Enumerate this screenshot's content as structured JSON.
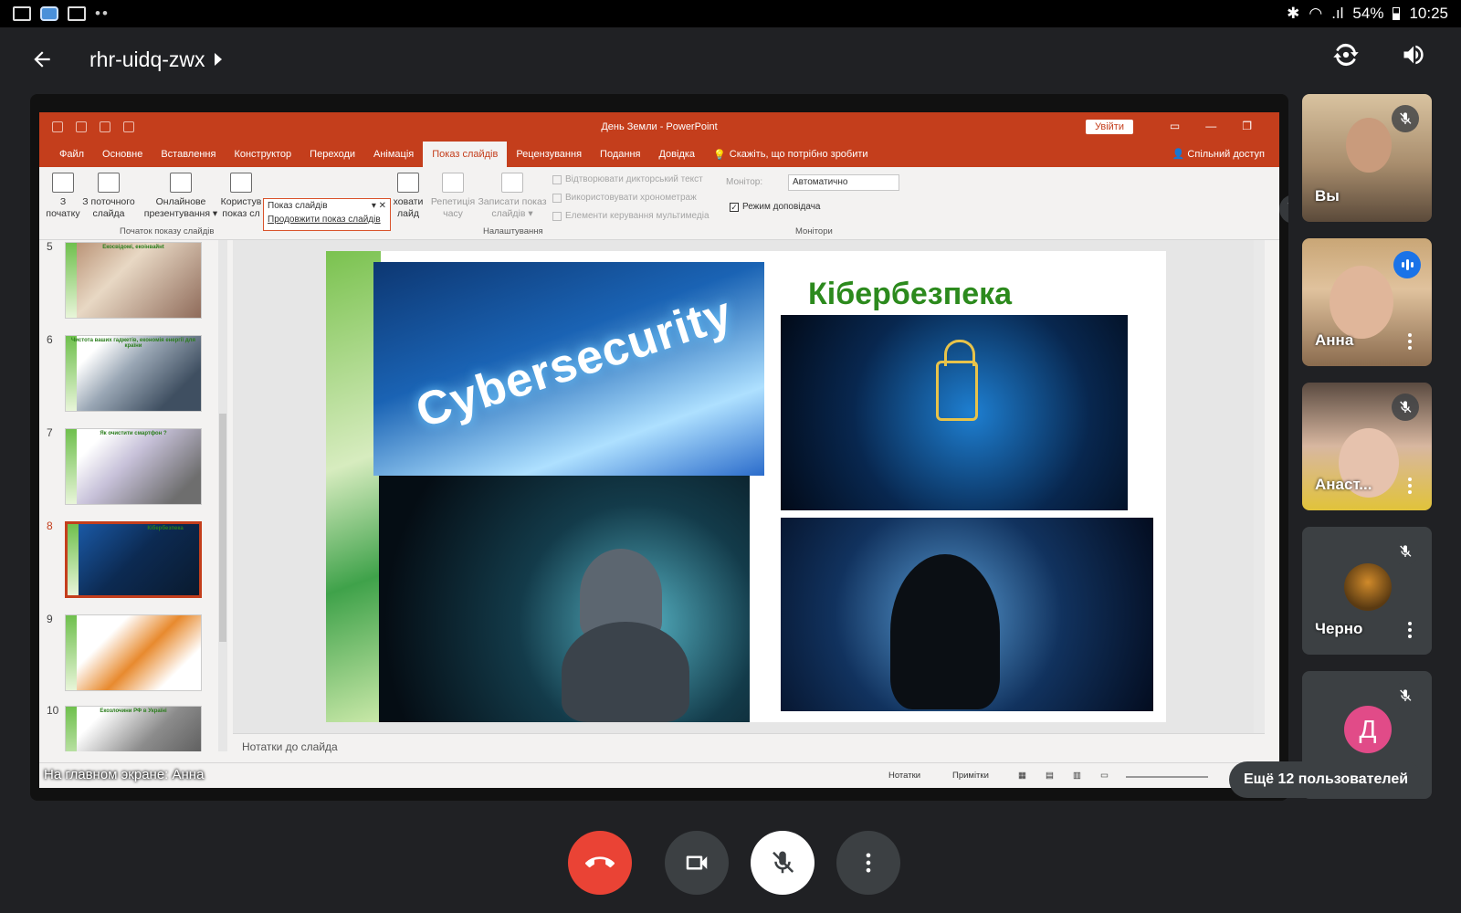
{
  "status_bar": {
    "battery": "54%",
    "time": "10:25",
    "signal_label": ".ıl"
  },
  "header": {
    "meeting_code": "rhr-uidq-zwx"
  },
  "powerpoint": {
    "doc_title": "День Земли  -  PowerPoint",
    "signin_label": "Увійти",
    "tabs": [
      "Файл",
      "Основне",
      "Вставлення",
      "Конструктор",
      "Переходи",
      "Анімація",
      "Показ слайдів",
      "Рецензування",
      "Подання",
      "Довідка"
    ],
    "tell_me": "Скажіть, що потрібно зробити",
    "share_label": "Спільний доступ",
    "ribbon": {
      "from_beginning": [
        "З",
        "початку"
      ],
      "from_current": [
        "З поточного",
        "слайда"
      ],
      "online": [
        "Онлайнове",
        "презентування ▾"
      ],
      "custom": [
        "Користув",
        "показ сл"
      ],
      "hide": [
        "ховати",
        "лайд"
      ],
      "rehearse": [
        "Репетиція",
        "часу"
      ],
      "record": [
        "Записати показ",
        "слайдів ▾"
      ],
      "group_start": "Початок показу слайдів",
      "group_setup": "Налаштування",
      "group_monitors": "Монітори",
      "checkbox_narration": "Відтворювати дикторський текст",
      "checkbox_timings": "Використовувати хронометраж",
      "checkbox_media": "Елементи керування мультимедіа",
      "monitor_label": "Монітор:",
      "monitor_value": "Автоматично",
      "presenter_view": "Режим доповідача",
      "popup_item1": "Показ слайдів",
      "popup_item2": "Продовжити показ слайдів"
    },
    "thumbnails": [
      {
        "num": "5",
        "title": "Екосвідомі, екоінвайнt"
      },
      {
        "num": "6",
        "title": "Чистота ваших гаджетів, економія енергії для країни"
      },
      {
        "num": "7",
        "title": "Як очистити смартфон ?"
      },
      {
        "num": "8",
        "title": "Кібербезпека"
      },
      {
        "num": "9",
        "title": ""
      },
      {
        "num": "10",
        "title": "Екозлочини РФ в Україні"
      }
    ],
    "slide": {
      "heading": "Кібербезпека",
      "image_word": "Cybersecurity"
    },
    "notes_placeholder": "Нотатки до слайда",
    "status": {
      "notes": "Нотатки",
      "comments": "Примітки"
    }
  },
  "presenter_label": "На главном экране: Анна",
  "participants": [
    {
      "name": "Вы"
    },
    {
      "name": "Анна"
    },
    {
      "name": "Анаст..."
    },
    {
      "name": "Черно"
    },
    {
      "name": "",
      "avatar_letter": "Д"
    }
  ],
  "more_users": "Ещё 12 пользователей",
  "colors": {
    "end_call": "#ea4335",
    "ppt_accent": "#c43e1c",
    "speaking_blue": "#1a73e8",
    "avatar_pink": "#e14b88"
  }
}
